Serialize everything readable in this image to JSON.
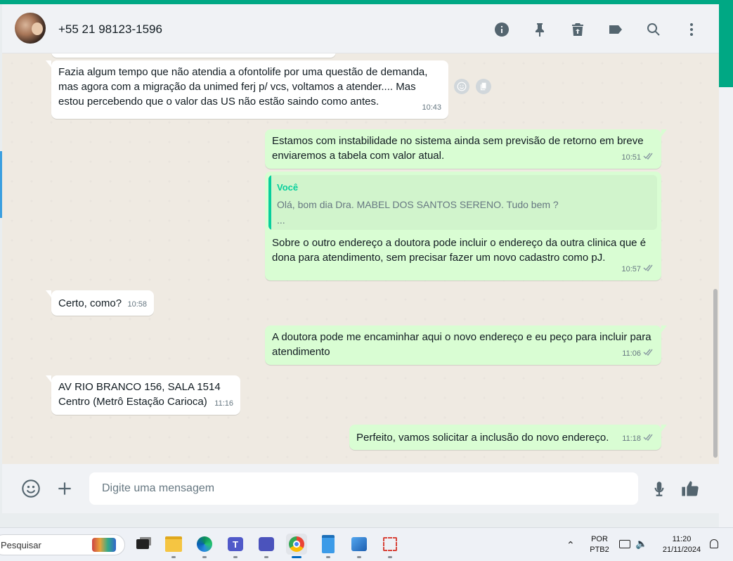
{
  "header": {
    "contact": "+55 21 98123-1596",
    "icons": [
      "info-icon",
      "pin-icon",
      "delete-icon",
      "label-icon",
      "search-icon",
      "menu-icon"
    ]
  },
  "messages": [
    {
      "id": 1,
      "dir": "in",
      "text": "Fazia algum tempo que não atendia a ofontolife por uma questão de demanda, mas agora com a migração da unimed ferj p/ vcs, voltamos a atender.... Mas estou percebendo que o valor das US não estão saindo como antes.",
      "time": "10:43"
    },
    {
      "id": 2,
      "dir": "out",
      "text": "Estamos com instabilidade no sistema ainda sem previsão de retorno em breve enviaremos a tabela com valor atual.",
      "time": "10:51"
    },
    {
      "id": 3,
      "dir": "out",
      "quote_author": "Você",
      "quote_line1": "Olá, bom dia Dra. MABEL DOS SANTOS SERENO. Tudo bem ?",
      "quote_line2": "...",
      "text": "Sobre o outro endereço a doutora pode incluir o endereço da outra clinica que é dona para atendimento, sem precisar fazer um novo cadastro como pJ.",
      "time": "10:57"
    },
    {
      "id": 4,
      "dir": "in",
      "text": "Certo, como?",
      "time": "10:58"
    },
    {
      "id": 5,
      "dir": "out",
      "text": "A doutora pode me encaminhar aqui o novo endereço e eu peço para incluir para atendimento",
      "time": "11:06"
    },
    {
      "id": 6,
      "dir": "in",
      "line1": "AV RIO BRANCO 156, SALA 1514",
      "line2": "Centro (Metrô Estação Carioca)",
      "time": "11:16"
    },
    {
      "id": 7,
      "dir": "out",
      "text": "Perfeito, vamos solicitar a inclusão do novo endereço.",
      "time": "11:18"
    }
  ],
  "composer": {
    "placeholder": "Digite uma mensagem",
    "icons": [
      "emoji-icon",
      "plus-icon",
      "mic-icon",
      "thumbs-up-icon"
    ]
  },
  "taskbar": {
    "search_placeholder": "Pesquisar",
    "lang1": "POR",
    "lang2": "PTB2",
    "time": "11:20",
    "date": "21/11/2024"
  },
  "colors": {
    "accent": "#00a884",
    "outgoing_bubble": "#d9fdd3",
    "incoming_bubble": "#ffffff",
    "read_ticks": "#8696a0"
  }
}
